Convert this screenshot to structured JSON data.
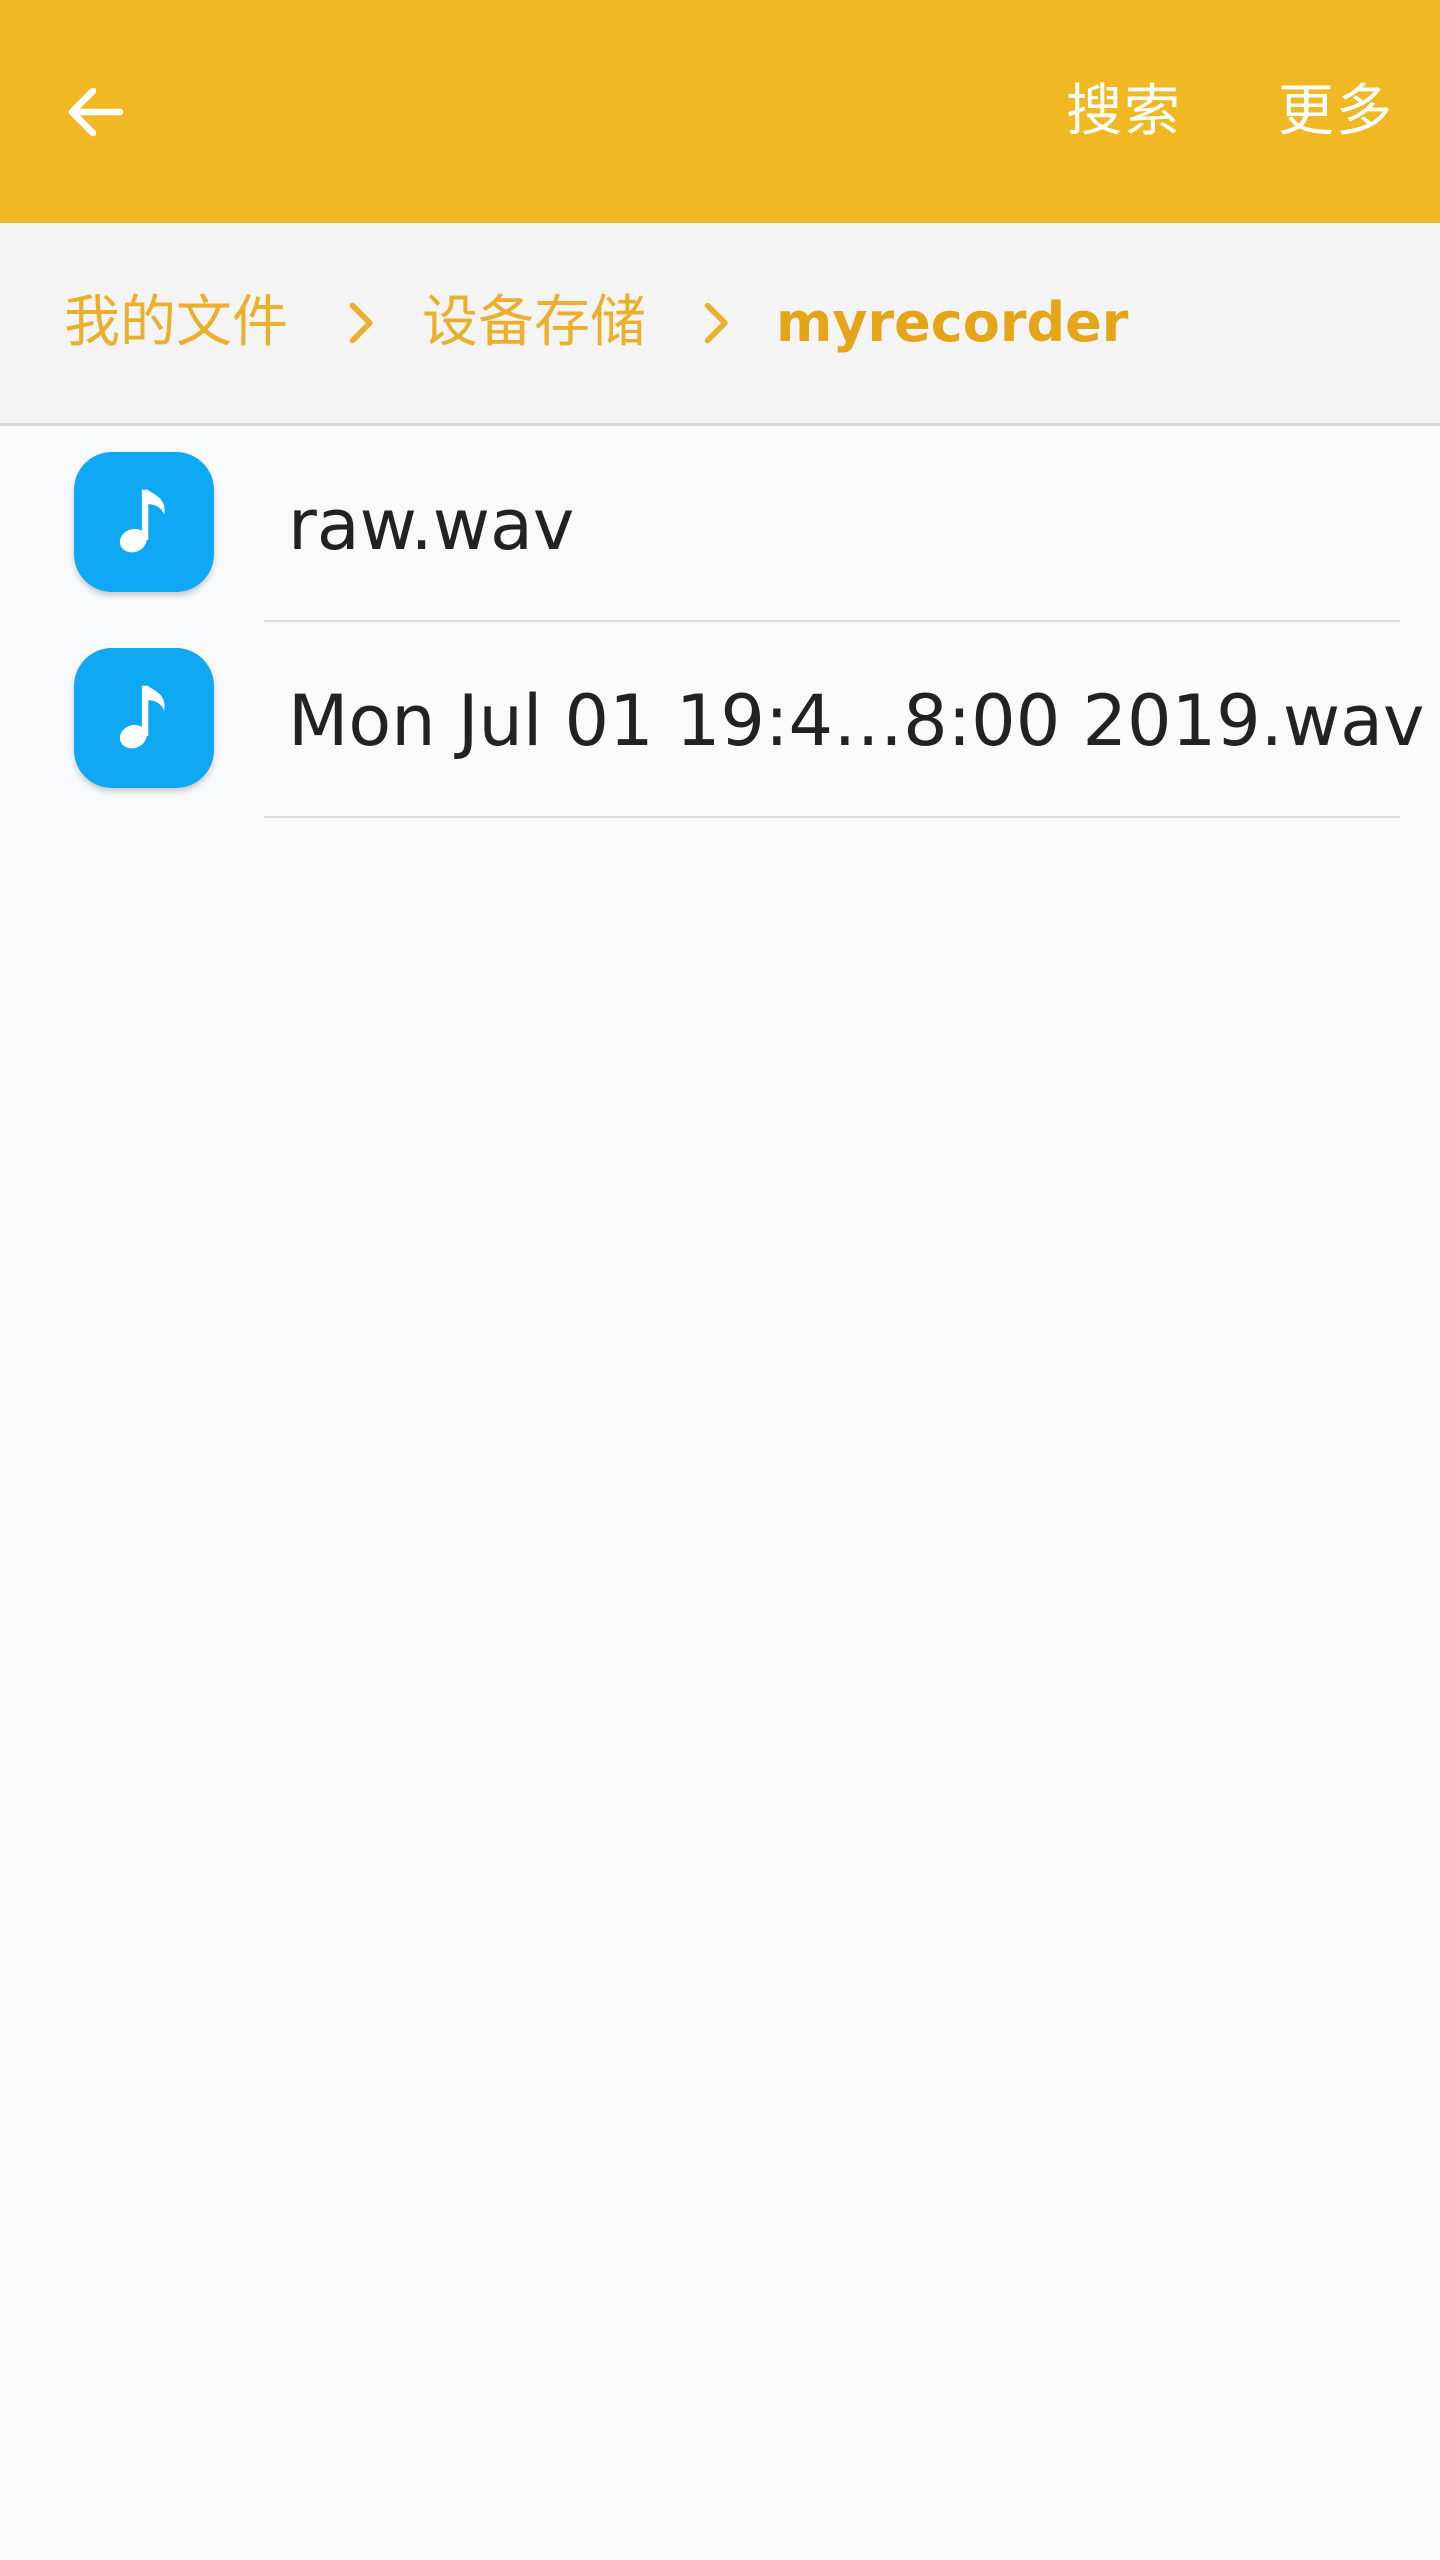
{
  "appbar": {
    "back_icon": "arrow-left-icon",
    "search_label": "搜索",
    "more_label": "更多",
    "color": "#f0b923"
  },
  "breadcrumb": {
    "items": [
      {
        "label": "我的文件"
      },
      {
        "label": "设备存储"
      },
      {
        "label": "myrecorder"
      }
    ],
    "separator_icon": "chevron-right-icon",
    "color": "#eab02d"
  },
  "files": [
    {
      "name": "raw.wav",
      "icon": "music-note-icon"
    },
    {
      "name": "Mon Jul 01 19:4…8:00 2019.wav",
      "icon": "music-note-icon"
    }
  ],
  "colors": {
    "file_icon_bg": "#0ea8f4",
    "background": "#f9fafb"
  }
}
